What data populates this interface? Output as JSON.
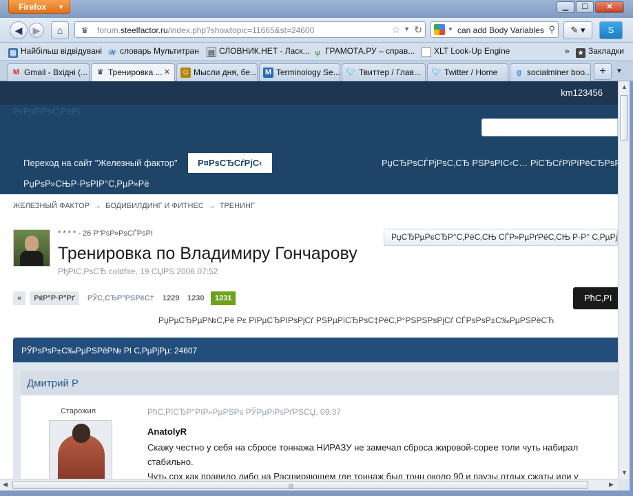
{
  "browser": {
    "app_button": "Firefox",
    "window_controls": {
      "minimize": "▁",
      "maximize": "☐",
      "close": "✕"
    },
    "url": {
      "prefix": "forum.",
      "domain": "steelfactor.ru",
      "path": "/index.php?showtopic=11665&st=24600"
    },
    "search": {
      "value": "can add Body Variables t"
    },
    "bookmarks": [
      {
        "label": "Найбільш відвідувані"
      },
      {
        "label": "словарь Мультитран"
      },
      {
        "label": "СЛОВНИК.НЕТ - Ласк..."
      },
      {
        "label": "ГРАМОТА.РУ – справ..."
      },
      {
        "label": "XLT Look-Up Engine"
      },
      {
        "label": "Закладки"
      }
    ],
    "bookmarks_more": "»",
    "tabs": [
      {
        "label": "Gmail - Вхідні (..."
      },
      {
        "label": "Тренировка ..."
      },
      {
        "label": "Мысли дня, бе..."
      },
      {
        "label": "Terminology Se..."
      },
      {
        "label": "Твиттер / Глав..."
      },
      {
        "label": "Twitter / Home"
      },
      {
        "label": "socialminer boo..."
      }
    ],
    "new_tab": "+"
  },
  "page": {
    "username": "km123456",
    "logo_text": "Р»РѕРіРѕС‚РёРї",
    "nav": {
      "site_link": "Переход на сайт \"Железный фактор\"",
      "forum": "Р¤РѕСЂСѓРјС‹",
      "right_link": "РџСЂРѕСЃРјРѕС‚СЂ РЅРѕРІС‹С… РіСЂСѓРїРїРёСЂРѕРІР°С‚СЊ",
      "second_row": "РџРѕР»СЊР·РѕРІР°С‚РµР»Рё"
    },
    "breadcrumb": {
      "items": [
        "ЖЕЛЕЗНЫЙ ФАКТОР",
        "БОДИБИЛДИНГ И ФИТНЕС",
        "ТРЕНИНГ"
      ],
      "separator": "→"
    },
    "topic": {
      "rating": "* * * * -  26 Р“РѕР»РѕСЃРѕРІ",
      "title": "Тренировка по Владимиру Гончарову",
      "meta": "РђРІС‚РѕСЂ coldfire, 19 СЏРЅ 2006 07:52",
      "follow_button": "РџСЂРµРєСЂР°С‚РёС‚СЊ СЃР»РµРґРёС‚СЊ Р·Р° С‚РµРјРѕР№"
    },
    "pagination": {
      "prev": "«",
      "first": "РќР°Р·Р°Рґ",
      "pages_label": "РЎС‚СЂР°РЅРёС†",
      "pages": [
        "1229",
        "1230"
      ],
      "current": "1231"
    },
    "reply_button": "РћС‚РІ",
    "share_line": "РџРµСЂРµР№С‚Рё Рє РїРµСЂРІРѕРјСѓ РЅРµРїСЂРѕС‡РёС‚Р°РЅРЅРѕРјСѓ СЃРѕРѕР±С‰РµРЅРёСЋ",
    "posts_bar": "РЎРѕРѕР±С‰РµРЅРёР№ РІ С‚РµРјРµ: 24607",
    "post": {
      "author": "Дмитрий Р",
      "rank": "Старожил",
      "date": "РћС‚РїСЂР°РІР»РµРЅРѕ РЎРµРіРѕРґРЅСЏ, 09:37",
      "quote_author": "AnatolyR",
      "lines": [
        "Скажу честно у себя на сбросе тоннажа НИРАЗУ не замечал сброса жировой-сорее толи чуть набирал",
        "стабильно.",
        "Чуть сох как правило либо на Расширяющем где тоннаж был тонн около 90 и паузы отдых сжаты или у"
      ]
    }
  }
}
